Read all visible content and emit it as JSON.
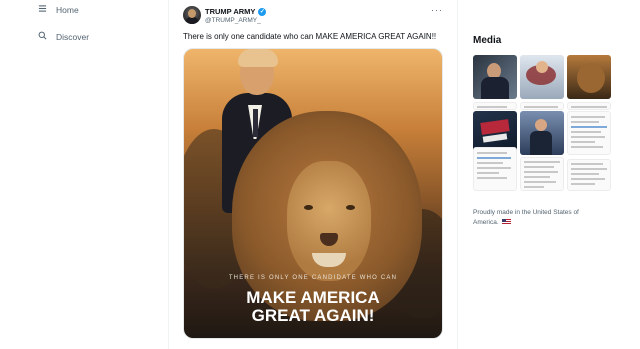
{
  "nav": {
    "items": [
      {
        "label": "Home",
        "icon": "home-icon"
      },
      {
        "label": "Discover",
        "icon": "search-icon"
      }
    ]
  },
  "tweet": {
    "display_name": "TRUMP ARMY",
    "handle": "@TRUMP_ARMY_",
    "verified": true,
    "text": "There is only one candidate who can MAKE AMERICA GREAT AGAIN!!",
    "image": {
      "subtitle": "THERE IS ONLY ONE CANDIDATE WHO CAN",
      "title_line1": "MAKE AMERICA",
      "title_line2": "GREAT AGAIN!"
    }
  },
  "sidebar": {
    "media_title": "Media",
    "footer_text": "Proudly made in the United States of America."
  },
  "colors": {
    "accent": "#1d9bf0",
    "text": "#0f1419",
    "secondary": "#536471"
  }
}
